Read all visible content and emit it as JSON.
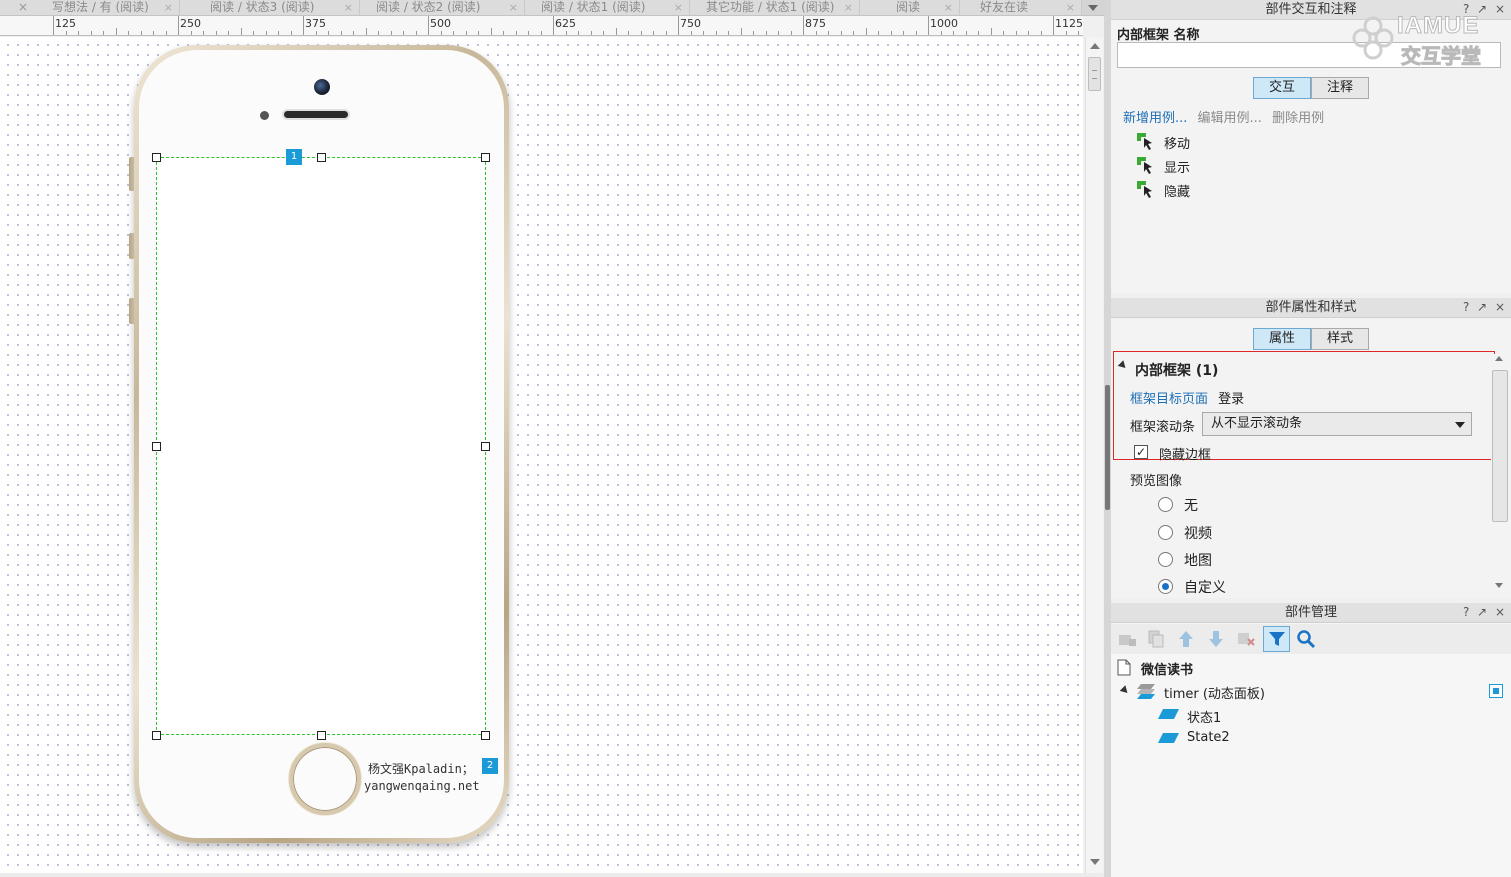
{
  "tabs": [
    {
      "label": "写想法 / 有 (阅读)"
    },
    {
      "label": "阅读 / 状态3 (阅读)"
    },
    {
      "label": "阅读 / 状态2 (阅读)"
    },
    {
      "label": "阅读 / 状态1 (阅读)"
    },
    {
      "label": "其它功能 / 状态1 (阅读)"
    },
    {
      "label": "阅读"
    },
    {
      "label": "好友在读"
    }
  ],
  "tab_close_glyph": "×",
  "ruler": [
    "125",
    "250",
    "375",
    "500",
    "625",
    "750",
    "875",
    "1000",
    "1125"
  ],
  "phone": {
    "watermark_line1": "杨文强Kpaladin；",
    "watermark_line2": "yangwenqaing.net",
    "badge1": "1",
    "badge2": "2"
  },
  "interaction_panel": {
    "title": "部件交互和注释",
    "help": "?",
    "pin": "↗",
    "close": "×",
    "name_label": "内部框架  名称",
    "name_value": "",
    "tab_interaction": "交互",
    "tab_notes": "注释",
    "new_case": "新增用例...",
    "edit_case": "编辑用例...",
    "delete_case": "删除用例",
    "events": [
      "移动",
      "显示",
      "隐藏"
    ],
    "watermark_brand": "IAMUE",
    "watermark_sub": "交互学堂"
  },
  "props_panel": {
    "title": "部件属性和样式",
    "help": "?",
    "pin": "↗",
    "close": "×",
    "tab_props": "属性",
    "tab_style": "样式",
    "section_title": "内部框架 (1)",
    "target_label": "框架目标页面",
    "target_value": "登录",
    "scroll_label": "框架滚动条",
    "scroll_value": "从不显示滚动条",
    "hide_border_label": "隐藏边框",
    "hide_border_checked": true,
    "preview_label": "预览图像",
    "preview_options": [
      "无",
      "视频",
      "地图",
      "自定义"
    ],
    "preview_selected": "自定义"
  },
  "widget_panel": {
    "title": "部件管理",
    "help": "?",
    "pin": "↗",
    "close": "×",
    "page_name": "微信读书",
    "tree_item": "timer (动态面板)",
    "states": [
      "状态1",
      "State2"
    ]
  },
  "colors": {
    "accent": "#1a9ad6",
    "selection": "#2bc22b",
    "highlight": "#e02626",
    "link": "#1f6fb5"
  }
}
